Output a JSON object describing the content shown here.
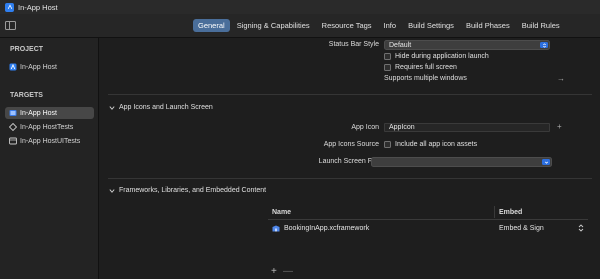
{
  "window": {
    "title": "In-App Host"
  },
  "tabs": [
    {
      "label": "General",
      "active": true
    },
    {
      "label": "Signing & Capabilities",
      "active": false
    },
    {
      "label": "Resource Tags",
      "active": false
    },
    {
      "label": "Info",
      "active": false
    },
    {
      "label": "Build Settings",
      "active": false
    },
    {
      "label": "Build Phases",
      "active": false
    },
    {
      "label": "Build Rules",
      "active": false
    }
  ],
  "sidebar": {
    "project_header": "PROJECT",
    "project_item": "In-App Host",
    "targets_header": "TARGETS",
    "targets": [
      {
        "label": "In-App Host",
        "selected": true
      },
      {
        "label": "In-App HostTests",
        "selected": false
      },
      {
        "label": "In-App HostUITests",
        "selected": false
      }
    ]
  },
  "deployment": {
    "status_bar_style_label": "Status Bar Style",
    "status_bar_style_value": "Default",
    "hide_during_launch": "Hide during application launch",
    "requires_full_screen": "Requires full screen",
    "supports_multiple_windows": "Supports multiple windows"
  },
  "app_icons": {
    "section_title": "App Icons and Launch Screen",
    "app_icon_label": "App Icon",
    "app_icon_value": "AppIcon",
    "app_icons_source_label": "App Icons Source",
    "include_all_label": "Include all app icon assets",
    "launch_screen_label": "Launch Screen File",
    "launch_screen_value": ""
  },
  "frameworks": {
    "section_title": "Frameworks, Libraries, and Embedded Content",
    "columns": {
      "name": "Name",
      "embed": "Embed"
    },
    "rows": [
      {
        "name": "BookingInApp.xcframework",
        "embed": "Embed & Sign"
      }
    ],
    "add_symbol": "+",
    "remove_symbol": "—"
  },
  "colors": {
    "accent": "#2c6fe0",
    "tab_active": "#4a6e9a",
    "background": "#1e1e1e",
    "sidebar": "#232323"
  }
}
